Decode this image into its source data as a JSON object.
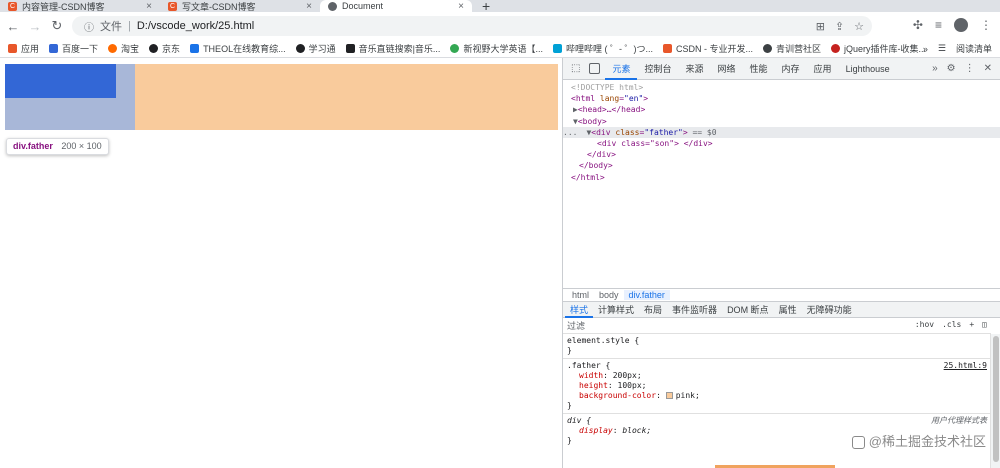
{
  "tabs": [
    {
      "title": "内容管理-CSDN博客",
      "favicon": "C"
    },
    {
      "title": "写文章-CSDN博客",
      "favicon": "C"
    },
    {
      "title": "Document",
      "favicon": ""
    }
  ],
  "tab_close": "×",
  "new_tab": "+",
  "nav": {
    "back": "←",
    "forward": "→",
    "reload": "↻"
  },
  "address": {
    "scheme_label": "文件",
    "separator": "|",
    "url": "D:/vscode_work/25.html"
  },
  "bookmarks": [
    {
      "label": "应用",
      "color": "#e8572a"
    },
    {
      "label": "百度一下",
      "color": "#3367d6"
    },
    {
      "label": "淘宝",
      "color": "#ff6a00"
    },
    {
      "label": "京东",
      "color": "#202124"
    },
    {
      "label": "THEOL在线教育综...",
      "color": "#1a73e8"
    },
    {
      "label": "学习通",
      "color": "#202124"
    },
    {
      "label": "音乐直链搜索|音乐...",
      "color": "#202124"
    },
    {
      "label": "新视野大学英语【...",
      "color": "#34a853"
    },
    {
      "label": "哔哩哔哩 ( ゜- ゜)つ...",
      "color": "#00a1d6"
    },
    {
      "label": "CSDN - 专业开发...",
      "color": "#e8572a"
    },
    {
      "label": "青训营社区",
      "color": "#3c4043"
    },
    {
      "label": "jQuery插件库-收集...",
      "color": "#c5221f"
    }
  ],
  "bookmarks_overflow": "»",
  "reading_list": "阅读清单",
  "page": {
    "tooltip_selector": "div.father",
    "tooltip_size": "200 × 100"
  },
  "devtools": {
    "tabs": [
      "元素",
      "控制台",
      "来源",
      "网络",
      "性能",
      "内存",
      "应用",
      "Lighthouse"
    ],
    "active_tab": 0,
    "overflow": "»",
    "elements": {
      "doctype": "<!DOCTYPE html>",
      "html_open_tag": "html",
      "html_lang_attr": "lang",
      "html_lang_val": "\"en\"",
      "head_collapsed": "<head>…</head>",
      "body_open": "<body>",
      "dots": "...",
      "div_father_tag": "div",
      "div_father_attr": "class",
      "div_father_val": "\"father\"",
      "eq_marker": "== $0",
      "div_son": "<div class=\"son\"> </div>",
      "div_close": "</div>",
      "body_close": "</body>",
      "html_close": "</html>"
    },
    "breadcrumb": [
      "html",
      "body",
      "div.father"
    ],
    "side_tabs": [
      "样式",
      "计算样式",
      "布局",
      "事件监听器",
      "DOM 断点",
      "属性",
      "无障碍功能"
    ],
    "filter_placeholder": "过滤",
    "filter_tools": [
      ":hov",
      ".cls",
      "+"
    ],
    "styles": {
      "element_style": "element.style {",
      "close_brace": "}",
      "father_selector": ".father {",
      "father_source": "25.html:9",
      "father_props": [
        {
          "name": "width",
          "value": "200px;"
        },
        {
          "name": "height",
          "value": "100px;"
        },
        {
          "name": "background-color",
          "value": "pink;"
        }
      ],
      "div_selector": "div {",
      "div_source": "用户代理样式表",
      "div_props": [
        {
          "name": "display",
          "value": "block;"
        }
      ]
    }
  },
  "watermark": "@稀土掘金技术社区"
}
